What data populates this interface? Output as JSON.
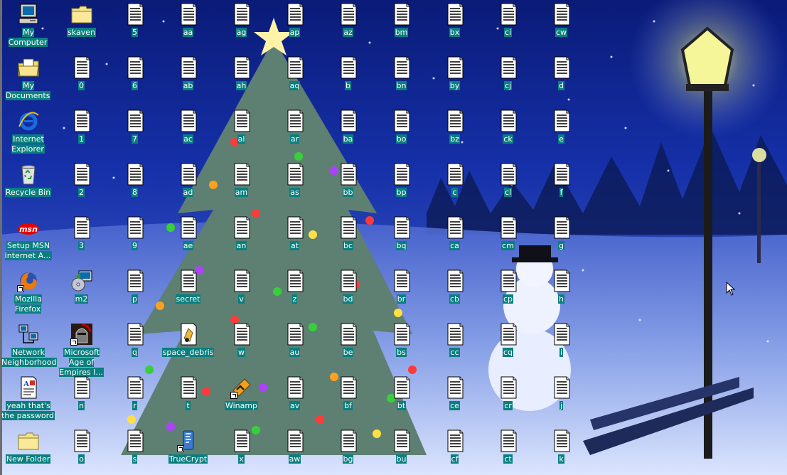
{
  "desktop": {
    "special_icons": [
      {
        "label": "My Computer",
        "icon": "my-computer-icon"
      },
      {
        "label": "skaven",
        "icon": "folder-icon"
      },
      {
        "label": "My Documents",
        "icon": "my-documents-icon"
      },
      {
        "label": "Internet Explorer",
        "icon": "internet-explorer-icon"
      },
      {
        "label": "Recycle Bin",
        "icon": "recycle-bin-icon"
      },
      {
        "label": "Setup MSN Internet A...",
        "icon": "msn-icon"
      },
      {
        "label": "Mozilla Firefox",
        "icon": "firefox-icon"
      },
      {
        "label": "m2",
        "icon": "installer-icon"
      },
      {
        "label": "Network Neighborhood",
        "icon": "network-icon"
      },
      {
        "label": "Microsoft Age of Empires I...",
        "icon": "age-of-empires-icon"
      },
      {
        "label": "yeah that's the password",
        "icon": "wordpad-document-icon"
      },
      {
        "label": "space_debris",
        "icon": "module-file-icon"
      },
      {
        "label": "Winamp",
        "icon": "winamp-icon"
      },
      {
        "label": "New Folder",
        "icon": "folder-icon"
      },
      {
        "label": "TrueCrypt",
        "icon": "truecrypt-icon"
      }
    ],
    "text_files": [
      "5",
      "aa",
      "ag",
      "ap",
      "az",
      "bm",
      "bx",
      "ci",
      "cw",
      "0",
      "6",
      "ab",
      "ah",
      "aq",
      "b",
      "bn",
      "by",
      "cj",
      "d",
      "1",
      "7",
      "ac",
      "al",
      "ar",
      "ba",
      "bo",
      "bz",
      "ck",
      "e",
      "2",
      "8",
      "ad",
      "am",
      "as",
      "bb",
      "bp",
      "c",
      "cl",
      "f",
      "3",
      "9",
      "ae",
      "an",
      "at",
      "bc",
      "bq",
      "ca",
      "cm",
      "g",
      "p",
      "secret",
      "v",
      "z",
      "bd",
      "br",
      "cb",
      "cp",
      "h",
      "q",
      "w",
      "au",
      "be",
      "bs",
      "cc",
      "cq",
      "i",
      "n",
      "r",
      "t",
      "av",
      "bf",
      "bt",
      "ce",
      "cr",
      "j",
      "o",
      "s",
      "x",
      "aw",
      "bg",
      "bu",
      "cf",
      "ct",
      "k"
    ]
  },
  "colors": {
    "label_bg": "#0a7f7f",
    "label_text": "#ffffff"
  }
}
